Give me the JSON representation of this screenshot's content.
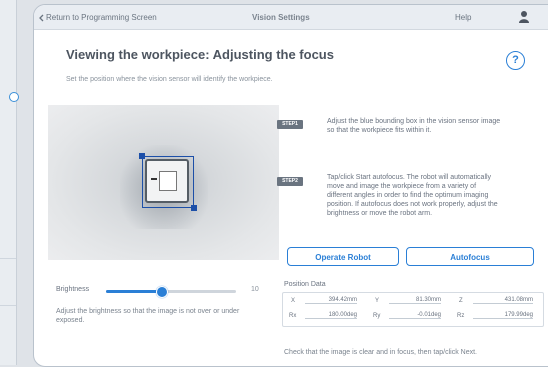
{
  "topbar": {
    "back_label": "Return to Programming Screen",
    "title": "Vision Settings",
    "help_label": "Help"
  },
  "page": {
    "heading": "Viewing the workpiece: Adjusting the focus",
    "subtext": "Set the position where the vision sensor will identify the workpiece.",
    "help_icon_glyph": "?"
  },
  "steps": [
    {
      "tag": "STEP1",
      "text": "Adjust the blue bounding box in the vision sensor image so that the workpiece fits within it."
    },
    {
      "tag": "STEP2",
      "text": "Tap/click Start autofocus. The robot will automatically move and image the workpiece from a variety of different angles in order to find the optimum imaging position. If autofocus does not work properly, adjust the brightness or move the robot arm."
    }
  ],
  "buttons": {
    "operate_robot": "Operate Robot",
    "autofocus": "Autofocus"
  },
  "brightness": {
    "label": "Brightness",
    "value_text": "10",
    "level_fraction": 0.42,
    "note": "Adjust the brightness so that the image is not over or under exposed."
  },
  "position": {
    "title": "Position Data",
    "rows": [
      [
        {
          "axis": "X",
          "value": "394.42mm"
        },
        {
          "axis": "Y",
          "value": "81.30mm"
        },
        {
          "axis": "Z",
          "value": "431.08mm"
        }
      ],
      [
        {
          "axis": "Rx",
          "value": "180.00deg"
        },
        {
          "axis": "Ry",
          "value": "-0.01deg"
        },
        {
          "axis": "Rz",
          "value": "179.99deg"
        }
      ]
    ]
  },
  "footer": {
    "text": "Check that the image is clear and in focus, then tap/click Next."
  },
  "colors": {
    "accent": "#2a7fd6",
    "bounding_box": "#1c4fa8",
    "step_tag": "#6a7480"
  }
}
